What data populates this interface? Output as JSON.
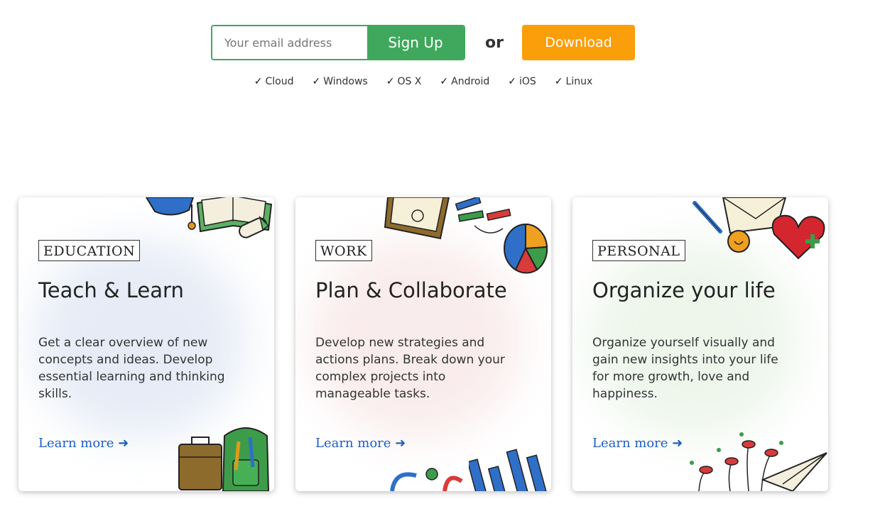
{
  "signup": {
    "email_placeholder": "Your email address",
    "signup_label": "Sign Up",
    "or_label": "or",
    "download_label": "Download"
  },
  "platforms": [
    "Cloud",
    "Windows",
    "OS X",
    "Android",
    "iOS",
    "Linux"
  ],
  "check_glyph": "✓",
  "cards": [
    {
      "tag": "EDUCATION",
      "title": "Teach & Learn",
      "description": "Get a clear overview of new concepts and ideas. Develop essential learning and thinking skills.",
      "link": "Learn more ➜",
      "icons": [
        "graduation-cap-icon",
        "open-book-icon",
        "diploma-icon",
        "briefcase-icon",
        "backpack-icon"
      ]
    },
    {
      "tag": "WORK",
      "title": "Plan & Collaborate",
      "description": "Develop new strategies and actions plans. Break down your complex projects into manageable tasks.",
      "link": "Learn more ➜",
      "icons": [
        "clipboard-icon",
        "markers-icon",
        "pie-chart-icon",
        "bar-chart-icon",
        "refresh-arrows-icon"
      ]
    },
    {
      "tag": "PERSONAL",
      "title": "Organize your life",
      "description": "Organize yourself visually and gain new insights into your life for more growth, love and happiness.",
      "link": "Learn more ➜",
      "icons": [
        "pen-icon",
        "envelope-icon",
        "lightbulb-icon",
        "heart-icon",
        "mindmap-icon",
        "paper-plane-icon"
      ]
    }
  ],
  "colors": {
    "signup_green": "#3fa85c",
    "download_orange": "#fa9e0a",
    "link_blue": "#1e5fbf"
  }
}
